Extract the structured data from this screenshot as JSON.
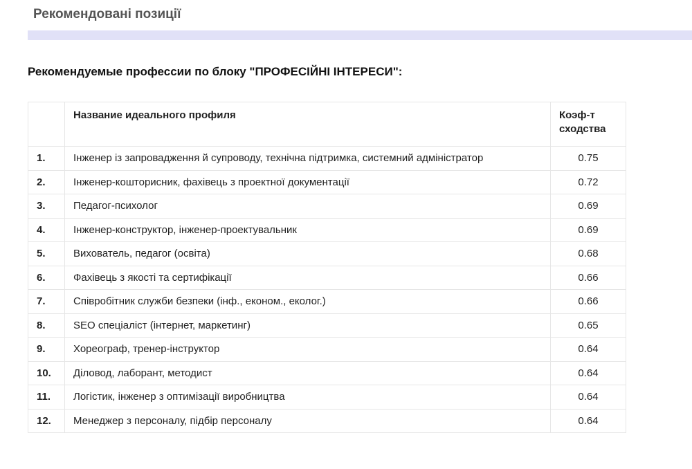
{
  "page_title": "Рекомендовані позиції",
  "section_title": "Рекомендуемые профессии по блоку \"ПРОФЕСІЙНІ ІНТЕРЕСИ\":",
  "table": {
    "headers": [
      "",
      "Название идеального профиля",
      "Коэф-т сходства"
    ],
    "rows": [
      {
        "n": "1.",
        "name": "Інженер із запровадження й супроводу, технічна підтримка, системний адміністратор",
        "score": "0.75"
      },
      {
        "n": "2.",
        "name": "Інженер-кошторисник, фахівець з проектної документації",
        "score": "0.72"
      },
      {
        "n": "3.",
        "name": "Педагог-психолог",
        "score": "0.69"
      },
      {
        "n": "4.",
        "name": "Інженер-конструктор, інженер-проектувальник",
        "score": "0.69"
      },
      {
        "n": "5.",
        "name": "Вихователь, педагог (освіта)",
        "score": "0.68"
      },
      {
        "n": "6.",
        "name": "Фахівець з якості та сертифікації",
        "score": "0.66"
      },
      {
        "n": "7.",
        "name": "Співробітник служби безпеки (інф., економ., еколог.)",
        "score": "0.66"
      },
      {
        "n": "8.",
        "name": "SEO спеціаліст (інтернет, маркетинг)",
        "score": "0.65"
      },
      {
        "n": "9.",
        "name": "Хореограф, тренер-інструктор",
        "score": "0.64"
      },
      {
        "n": "10.",
        "name": "Діловод, лаборант, методист",
        "score": "0.64"
      },
      {
        "n": "11.",
        "name": "Логістик, інженер з оптимізації виробництва",
        "score": "0.64"
      },
      {
        "n": "12.",
        "name": "Менеджер з персоналу, підбір персоналу",
        "score": "0.64"
      }
    ]
  }
}
